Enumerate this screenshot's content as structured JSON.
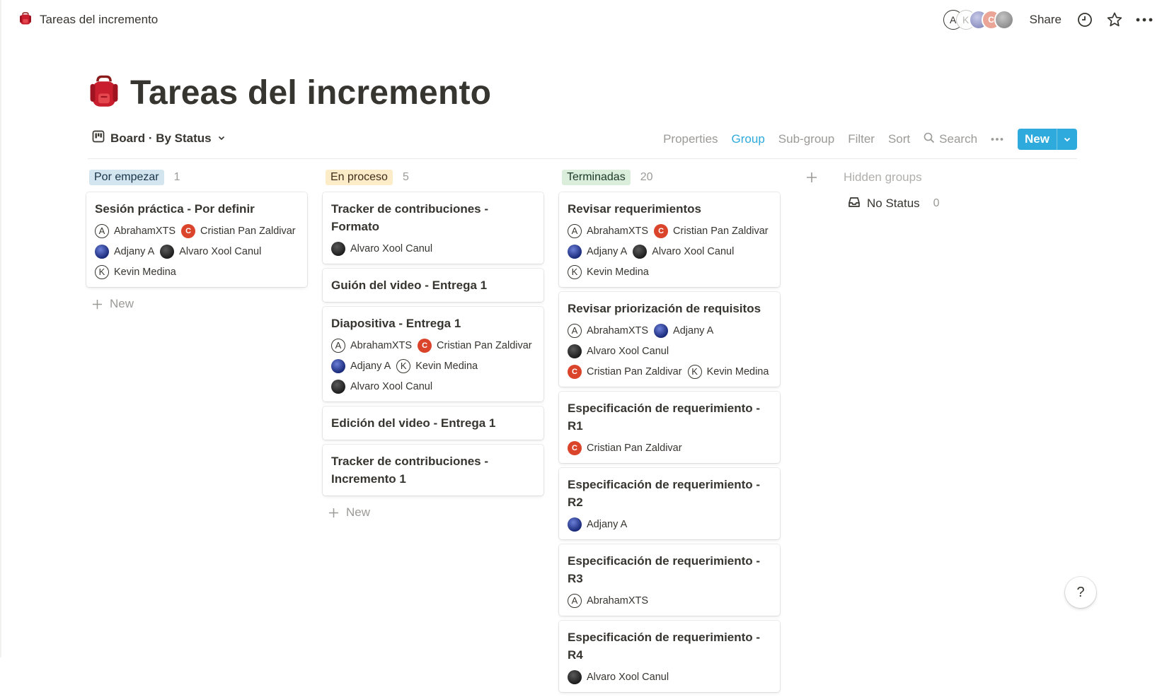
{
  "page": {
    "breadcrumb": "Tareas del incremento",
    "title": "Tareas del incremento",
    "icon": "red-backpack-icon"
  },
  "topbar": {
    "collaborators": [
      {
        "initial": "A",
        "style": "outline"
      },
      {
        "initial": "K",
        "style": "outline"
      },
      {
        "initial": "",
        "style": "photo"
      },
      {
        "initial": "C",
        "style": "orange"
      },
      {
        "initial": "",
        "style": "photo"
      }
    ],
    "share_label": "Share",
    "icons": [
      "clock-icon",
      "star-icon",
      "more-horizontal-icon"
    ]
  },
  "view": {
    "name": "Board · By Status",
    "tools": {
      "properties": "Properties",
      "group": "Group",
      "subgroup": "Sub-group",
      "filter": "Filter",
      "sort": "Sort",
      "search": "Search"
    },
    "new_label": "New",
    "colors": {
      "accent": "#2eaadc"
    }
  },
  "columns": [
    {
      "label": "Por empezar",
      "count": "1",
      "bg": "#d3e5ef",
      "fg": "#183347",
      "cards": [
        {
          "title": "Sesión práctica - Por definir",
          "people": [
            {
              "name": "AbrahamXTS",
              "avatar": "outline",
              "initial": "A"
            },
            {
              "name": "Cristian Pan Zaldivar",
              "avatar": "orange",
              "initial": "C"
            },
            {
              "name": "Adjany A",
              "avatar": "blue",
              "initial": ""
            },
            {
              "name": "Alvaro Xool Canul",
              "avatar": "dark",
              "initial": ""
            },
            {
              "name": "Kevin Medina",
              "avatar": "outline",
              "initial": "K"
            }
          ]
        }
      ],
      "new_label": "New"
    },
    {
      "label": "En proceso",
      "count": "5",
      "bg": "#fdecc8",
      "fg": "#402c1b",
      "cards": [
        {
          "title": "Tracker de contribuciones - Formato",
          "people": [
            {
              "name": "Alvaro Xool Canul",
              "avatar": "dark",
              "initial": ""
            }
          ]
        },
        {
          "title": "Guión del video - Entrega 1",
          "people": []
        },
        {
          "title": "Diapositiva - Entrega 1",
          "people": [
            {
              "name": "AbrahamXTS",
              "avatar": "outline",
              "initial": "A"
            },
            {
              "name": "Cristian Pan Zaldivar",
              "avatar": "orange",
              "initial": "C"
            },
            {
              "name": "Adjany A",
              "avatar": "blue",
              "initial": ""
            },
            {
              "name": "Kevin Medina",
              "avatar": "outline",
              "initial": "K"
            },
            {
              "name": "Alvaro Xool Canul",
              "avatar": "dark",
              "initial": ""
            }
          ]
        },
        {
          "title": "Edición del video - Entrega 1",
          "people": []
        },
        {
          "title": "Tracker de contribuciones - Incremento 1",
          "people": []
        }
      ],
      "new_label": "New"
    },
    {
      "label": "Terminadas",
      "count": "20",
      "bg": "#dbeddb",
      "fg": "#1c3829",
      "cards": [
        {
          "title": "Revisar requerimientos",
          "people": [
            {
              "name": "AbrahamXTS",
              "avatar": "outline",
              "initial": "A"
            },
            {
              "name": "Cristian Pan Zaldivar",
              "avatar": "orange",
              "initial": "C"
            },
            {
              "name": "Adjany A",
              "avatar": "blue",
              "initial": ""
            },
            {
              "name": "Alvaro Xool Canul",
              "avatar": "dark",
              "initial": ""
            },
            {
              "name": "Kevin Medina",
              "avatar": "outline",
              "initial": "K"
            }
          ]
        },
        {
          "title": "Revisar priorización de requisitos",
          "people": [
            {
              "name": "AbrahamXTS",
              "avatar": "outline",
              "initial": "A"
            },
            {
              "name": "Adjany A",
              "avatar": "blue",
              "initial": ""
            },
            {
              "name": "Alvaro Xool Canul",
              "avatar": "dark",
              "initial": ""
            },
            {
              "name": "Cristian Pan Zaldivar",
              "avatar": "orange",
              "initial": "C"
            },
            {
              "name": "Kevin Medina",
              "avatar": "outline",
              "initial": "K"
            }
          ]
        },
        {
          "title": "Especificación de requerimiento - R1",
          "people": [
            {
              "name": "Cristian Pan Zaldivar",
              "avatar": "orange",
              "initial": "C"
            }
          ]
        },
        {
          "title": "Especificación de requerimiento - R2",
          "people": [
            {
              "name": "Adjany A",
              "avatar": "blue",
              "initial": ""
            }
          ]
        },
        {
          "title": "Especificación de requerimiento - R3",
          "people": [
            {
              "name": "AbrahamXTS",
              "avatar": "outline",
              "initial": "A"
            }
          ]
        },
        {
          "title": "Especificación de requerimiento - R4",
          "people": [
            {
              "name": "Alvaro Xool Canul",
              "avatar": "dark",
              "initial": ""
            }
          ]
        }
      ],
      "new_label": ""
    }
  ],
  "hidden": {
    "title": "Hidden groups",
    "no_status_label": "No Status",
    "no_status_count": "0"
  },
  "help_label": "?"
}
